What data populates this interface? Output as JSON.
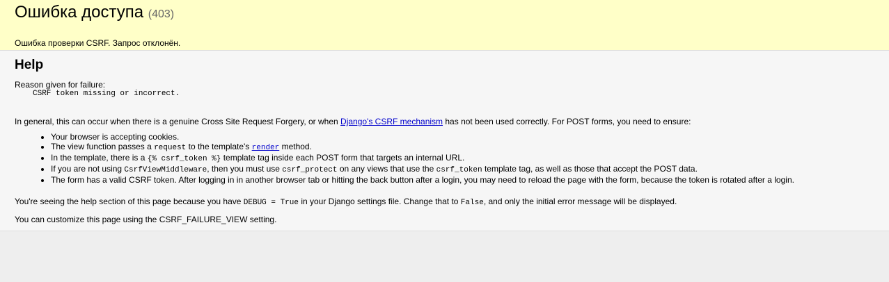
{
  "summary": {
    "title": "Ошибка доступа",
    "code": "(403)",
    "message": "Ошибка проверки CSRF. Запрос отклонён."
  },
  "help": {
    "heading": "Help",
    "reason_label": "Reason given for failure:",
    "reason_value": "CSRF token missing or incorrect.",
    "general": {
      "before": "In general, this can occur when there is a genuine Cross Site Request Forgery, or when ",
      "link": "Django's CSRF mechanism",
      "after": " has not been used correctly. For POST forms, you need to ensure:"
    },
    "checks": {
      "c1": "Your browser is accepting cookies.",
      "c2_a": "The view function passes a ",
      "c2_code": "request",
      "c2_b": " to the template's ",
      "c2_link": "render",
      "c2_c": " method.",
      "c3_a": "In the template, there is a ",
      "c3_code": "{% csrf_token %}",
      "c3_b": " template tag inside each POST form that targets an internal URL.",
      "c4_a": "If you are not using ",
      "c4_code1": "CsrfViewMiddleware",
      "c4_b": ", then you must use ",
      "c4_code2": "csrf_protect",
      "c4_c": " on any views that use the ",
      "c4_code3": "csrf_token",
      "c4_d": " template tag, as well as those that accept the POST data.",
      "c5": "The form has a valid CSRF token. After logging in in another browser tab or hitting the back button after a login, you may need to reload the page with the form, because the token is rotated after a login."
    },
    "debug": {
      "a": "You're seeing the help section of this page because you have ",
      "code1": "DEBUG = True",
      "b": " in your Django settings file. Change that to ",
      "code2": "False",
      "c": ", and only the initial error message will be displayed."
    },
    "custom": "You can customize this page using the CSRF_FAILURE_VIEW setting."
  }
}
